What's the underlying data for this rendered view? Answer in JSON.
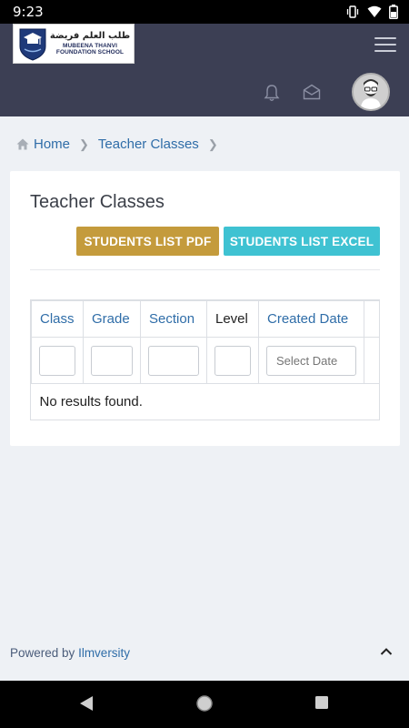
{
  "status_bar": {
    "time": "9:23"
  },
  "header": {
    "logo": {
      "arabic": "طلب العلم فريضة",
      "name_line1": "MUBEENA THANVI",
      "name_line2": "FOUNDATION SCHOOL"
    },
    "icons": [
      "bell-icon",
      "envelope-icon",
      "avatar"
    ]
  },
  "breadcrumb": {
    "home": "Home",
    "current": "Teacher Classes"
  },
  "card": {
    "title": "Teacher Classes",
    "buttons": {
      "pdf": "STUDENTS LIST PDF",
      "excel": "STUDENTS LIST EXCEL"
    },
    "colors": {
      "pdf": "#c49b3c",
      "excel": "#3fc2d2"
    },
    "table": {
      "columns": [
        "Class",
        "Grade",
        "Section",
        "Level",
        "Created Date"
      ],
      "filters": {
        "class": "",
        "grade": "",
        "section": "",
        "level": "",
        "created_date_placeholder": "Select Date"
      },
      "empty_message": "No results found."
    }
  },
  "footer": {
    "powered_by": "Powered by",
    "brand": "Ilmversity"
  }
}
